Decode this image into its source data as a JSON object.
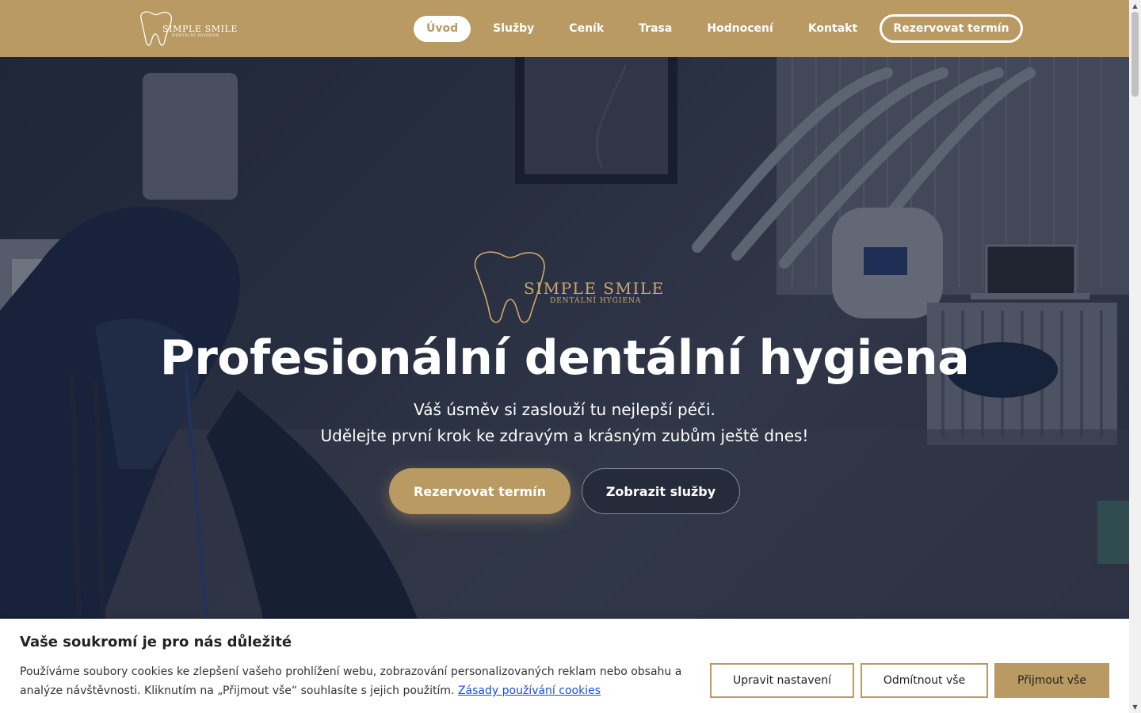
{
  "brand": {
    "name": "SIMPLE SMILE",
    "tagline": "DENTÁLNÍ HYGIENA"
  },
  "nav": {
    "items": [
      {
        "label": "Úvod",
        "active": true
      },
      {
        "label": "Služby"
      },
      {
        "label": "Ceník"
      },
      {
        "label": "Trasa"
      },
      {
        "label": "Hodnocení"
      },
      {
        "label": "Kontakt"
      }
    ],
    "cta_label": "Rezervovat termín"
  },
  "hero": {
    "title": "Profesionální dentální hygiena",
    "subtitle_line1": "Váš úsměv si zaslouží tu nejlepší péči.",
    "subtitle_line2": "Udělejte první krok ke zdravým a krásným zubům ještě dnes!",
    "primary_button": "Rezervovat termín",
    "secondary_button": "Zobrazit služby"
  },
  "cookie": {
    "title": "Vaše soukromí je pro nás důležité",
    "text": "Používáme soubory cookies ke zlepšení vašeho prohlížení webu, zobrazování personalizovaných reklam nebo obsahu a analýze návštěvnosti. Kliknutím na „Přijmout vše“ souhlasíte s jejich použitím.",
    "link_label": "Zásady používání cookies",
    "settings_button": "Upravit nastavení",
    "reject_button": "Odmítnout vše",
    "accept_button": "Přijmout vše"
  },
  "colors": {
    "accent": "#b89a62",
    "hero_gold": "#c9a870",
    "link": "#1a4fd6"
  },
  "icons": {
    "logo": "tooth-outline-icon",
    "scroll_up": "triangle-up-icon",
    "scroll_down": "triangle-down-icon"
  }
}
